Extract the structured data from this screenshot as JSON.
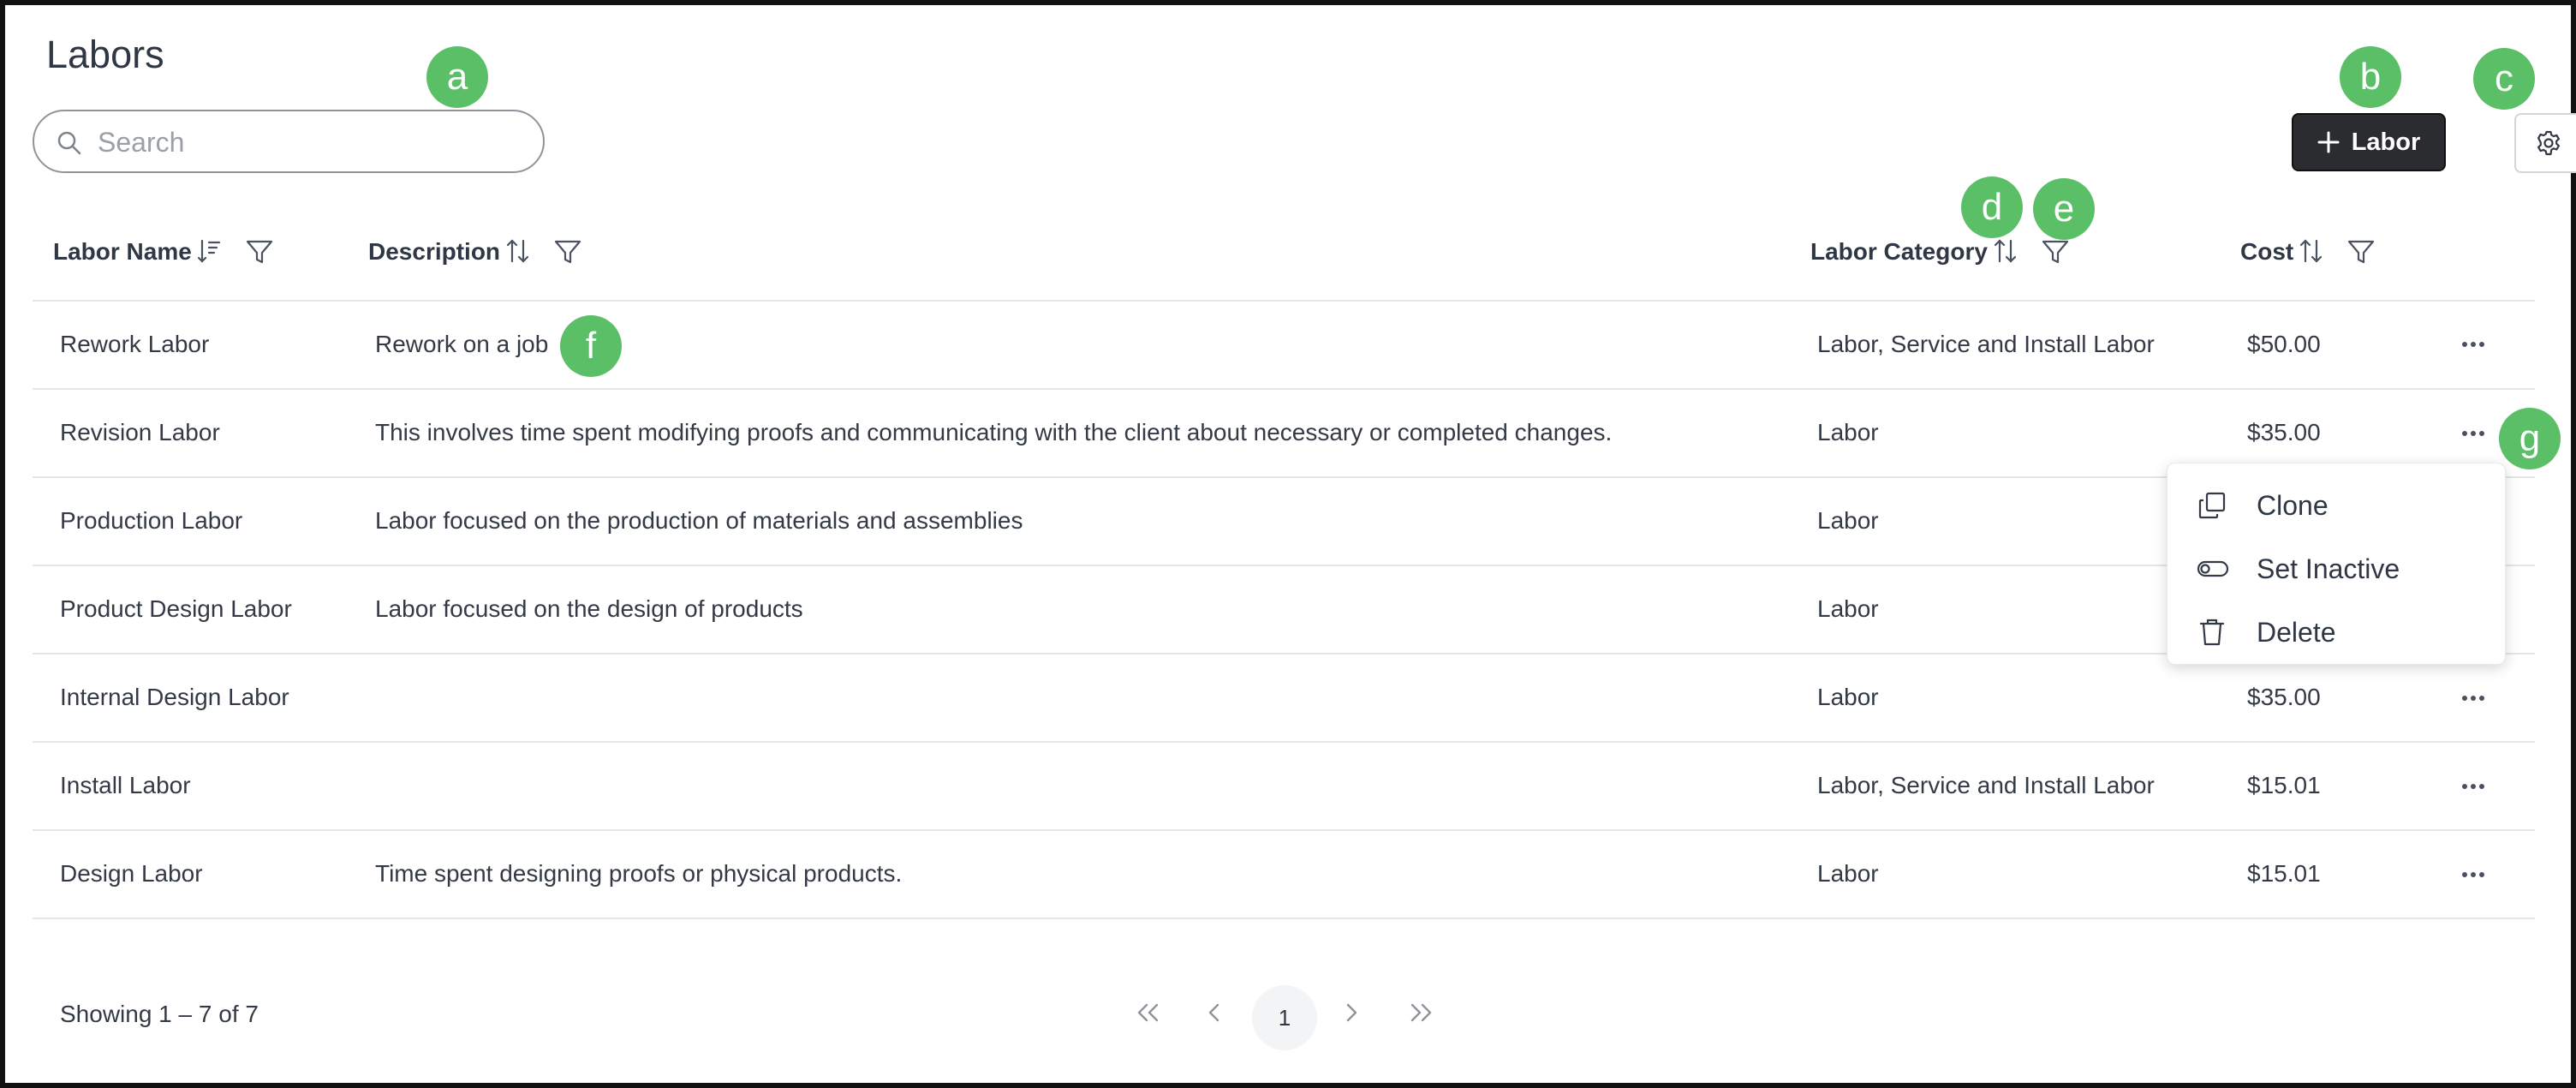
{
  "page": {
    "title": "Labors"
  },
  "search": {
    "placeholder": "Search",
    "value": ""
  },
  "toolbar": {
    "add_label": "Labor"
  },
  "table": {
    "headers": {
      "name": "Labor Name",
      "description": "Description",
      "category": "Labor Category",
      "cost": "Cost"
    },
    "rows": [
      {
        "name": "Rework Labor",
        "description": "Rework on a job",
        "category": "Labor, Service and Install Labor",
        "cost": "$50.00"
      },
      {
        "name": "Revision Labor",
        "description": "This involves time spent modifying proofs and communicating with the client about necessary or completed changes.",
        "category": "Labor",
        "cost": "$35.00"
      },
      {
        "name": "Production Labor",
        "description": "Labor focused on the production of materials and assemblies",
        "category": "Labor",
        "cost": ""
      },
      {
        "name": "Product Design Labor",
        "description": "Labor focused on the design of products",
        "category": "Labor",
        "cost": ""
      },
      {
        "name": "Internal Design Labor",
        "description": "",
        "category": "Labor",
        "cost": "$35.00"
      },
      {
        "name": "Install Labor",
        "description": "",
        "category": "Labor, Service and Install Labor",
        "cost": "$15.01"
      },
      {
        "name": "Design Labor",
        "description": "Time spent designing proofs or physical products.",
        "category": "Labor",
        "cost": "$15.01"
      }
    ]
  },
  "context_menu": {
    "items": [
      {
        "label": "Clone",
        "icon": "clone-icon"
      },
      {
        "label": "Set Inactive",
        "icon": "toggle-icon"
      },
      {
        "label": "Delete",
        "icon": "trash-icon"
      }
    ]
  },
  "pagination": {
    "summary": "Showing 1 – 7 of 7",
    "current_page": "1"
  },
  "annotations": [
    "a",
    "b",
    "c",
    "d",
    "e",
    "f",
    "g"
  ],
  "colors": {
    "accent_badge": "#5bbf68",
    "primary_button": "#2b2c2f",
    "divider": "#e3e5e8"
  }
}
